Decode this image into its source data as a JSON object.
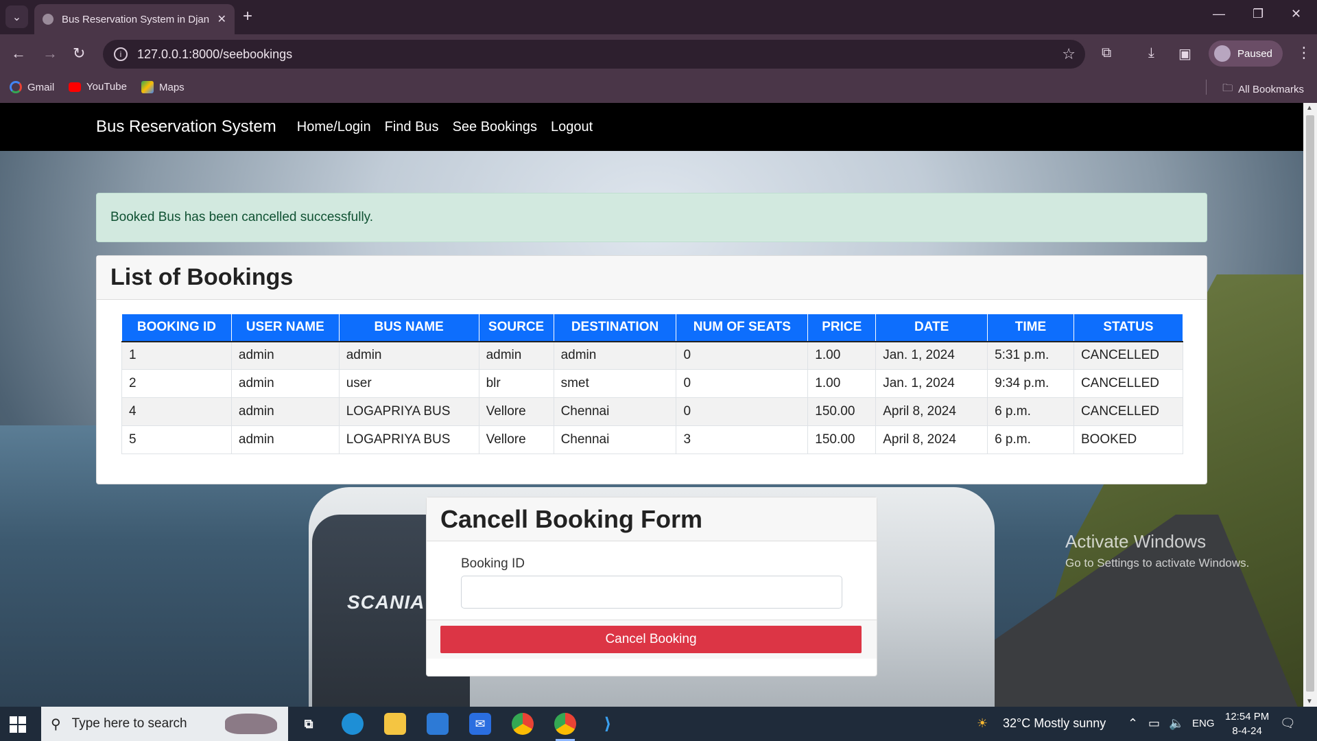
{
  "browser": {
    "tab_title": "Bus Reservation System in Djan",
    "url": "127.0.0.1:8000/seebookings",
    "profile_label": "Paused",
    "bookmarks": [
      {
        "label": "Gmail",
        "icon": "google-icon"
      },
      {
        "label": "YouTube",
        "icon": "youtube-icon"
      },
      {
        "label": "Maps",
        "icon": "maps-icon"
      }
    ],
    "all_bookmarks_label": "All Bookmarks"
  },
  "nav": {
    "brand": "Bus Reservation System",
    "links": [
      "Home/Login",
      "Find Bus",
      "See Bookings",
      "Logout"
    ]
  },
  "alert": {
    "message": "Booked Bus has been cancelled successfully.",
    "color": "#d2e9df"
  },
  "bookings": {
    "title": "List of Bookings",
    "columns": [
      "BOOKING ID",
      "USER NAME",
      "BUS NAME",
      "SOURCE",
      "DESTINATION",
      "NUM OF SEATS",
      "PRICE",
      "DATE",
      "TIME",
      "STATUS"
    ],
    "rows": [
      [
        "1",
        "admin",
        "admin",
        "admin",
        "admin",
        "0",
        "1.00",
        "Jan. 1, 2024",
        "5:31 p.m.",
        "CANCELLED"
      ],
      [
        "2",
        "admin",
        "user",
        "blr",
        "smet",
        "0",
        "1.00",
        "Jan. 1, 2024",
        "9:34 p.m.",
        "CANCELLED"
      ],
      [
        "4",
        "admin",
        "LOGAPRIYA BUS",
        "Vellore",
        "Chennai",
        "0",
        "150.00",
        "April 8, 2024",
        "6 p.m.",
        "CANCELLED"
      ],
      [
        "5",
        "admin",
        "LOGAPRIYA BUS",
        "Vellore",
        "Chennai",
        "3",
        "150.00",
        "April 8, 2024",
        "6 p.m.",
        "BOOKED"
      ]
    ],
    "header_color": "#0d6efd"
  },
  "cancel_form": {
    "title": "Cancell Booking Form",
    "field_label": "Booking ID",
    "field_value": "",
    "button_label": "Cancel Booking",
    "button_color": "#dc3545"
  },
  "background": {
    "bus_logo_text": "SCANIA"
  },
  "watermark": {
    "line1": "Activate Windows",
    "line2": "Go to Settings to activate Windows."
  },
  "taskbar": {
    "search_placeholder": "Type here to search",
    "weather": "32°C  Mostly sunny",
    "language": "ENG",
    "time": "12:54 PM",
    "date": "8-4-24"
  }
}
